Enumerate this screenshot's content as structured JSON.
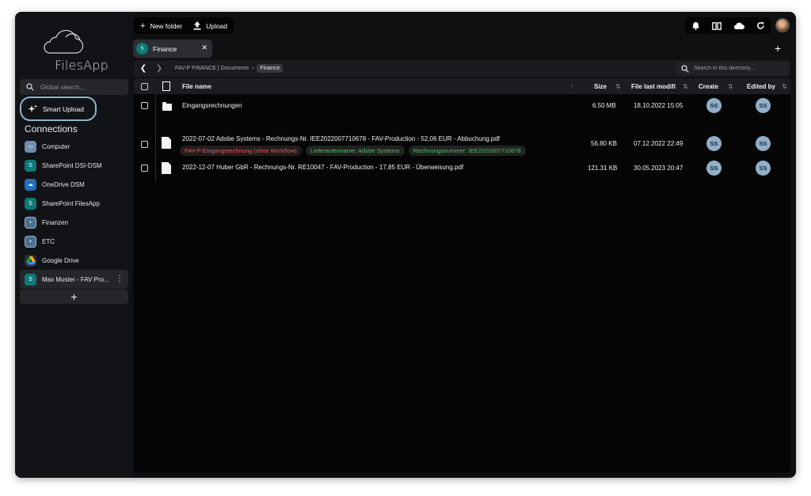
{
  "app": {
    "name": "FilesApp"
  },
  "sidebar": {
    "search_placeholder": "Global search...",
    "smart_upload_label": "Smart Upload",
    "connections_heading": "Connections",
    "connections": [
      {
        "label": "Computer",
        "icon": "computer-icon"
      },
      {
        "label": "SharePoint DSI-DSM",
        "icon": "sharepoint-icon"
      },
      {
        "label": "OneDrive DSM",
        "icon": "onedrive-icon"
      },
      {
        "label": "SharePoint FilesApp",
        "icon": "sharepoint-icon"
      },
      {
        "label": "Finanzen",
        "icon": "folder-icon"
      },
      {
        "label": "ETC",
        "icon": "folder-icon"
      },
      {
        "label": "Google Drive",
        "icon": "google-drive-icon"
      },
      {
        "label": "Max Muster - FAV Pro...",
        "icon": "sharepoint-icon"
      }
    ]
  },
  "toolbar": {
    "new_folder_label": "New folder",
    "upload_label": "Upload"
  },
  "tab": {
    "label": "Finance"
  },
  "breadcrumb": {
    "path": "FAV-P FINANCE | Documents",
    "separator": "›",
    "current": "Finance"
  },
  "dir_search_placeholder": "Search in this directory...",
  "table": {
    "headers": {
      "file_name": "File name",
      "size": "Size",
      "modified": "File last modifi",
      "created": "Create",
      "edited": "Edited by"
    },
    "rows": [
      {
        "type": "folder",
        "name": "Eingangsrechnungen",
        "size": "6.50 MB",
        "modified": "18.10.2022 15:05",
        "created_by": "SS",
        "edited_by": "SS",
        "tags": []
      },
      {
        "type": "file",
        "name": "2022-07-02 Adobe Systems - Rechnungs-Nr. IEE2022007710678 - FAV-Production - 52,06 EUR - Abbuchung.pdf",
        "size": "56.80 KB",
        "modified": "07.12.2022 22:49",
        "created_by": "SS",
        "edited_by": "SS",
        "tags": [
          {
            "text": "FAV-P Eingangsrechnung (ohne Workflow)",
            "color": "#e05a5a"
          },
          {
            "text": "Lieferantenname: Adobe Systems",
            "color": "#5fb76b"
          },
          {
            "text": "Rechnungsnummer: IEE2022007710678",
            "color": "#5fb76b"
          }
        ]
      },
      {
        "type": "file",
        "name": "2022-12-07 Huber GbR - Rechnungs-Nr. RE10047 - FAV-Production - 17,85 EUR - Überweisung.pdf",
        "size": "121.31 KB",
        "modified": "30.05.2023 20:47",
        "created_by": "SS",
        "edited_by": "SS",
        "tags": []
      }
    ]
  },
  "colors": {
    "window_bg": "#0f1012",
    "accent": "#8fb3c9",
    "avatar_badge": "#8fb0c8",
    "tag_red": "#e05a5a",
    "tag_green": "#5fb76b"
  }
}
